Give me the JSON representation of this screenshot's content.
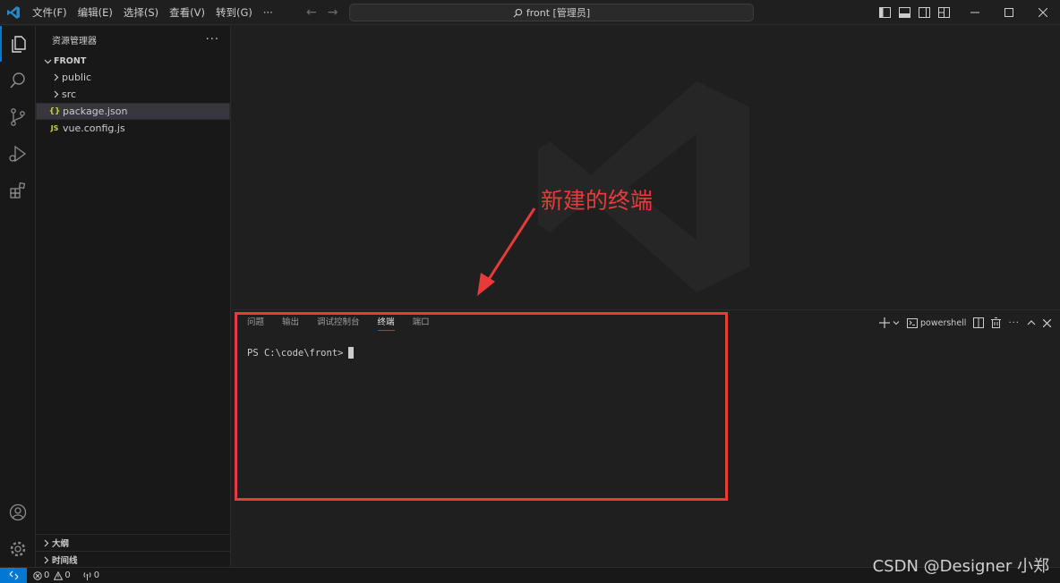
{
  "menu": [
    "文件(F)",
    "编辑(E)",
    "选择(S)",
    "查看(V)",
    "转到(G)",
    "···"
  ],
  "command_center": {
    "text": "front [管理员]"
  },
  "sidebar": {
    "title": "资源管理器",
    "more": "···",
    "folder": "FRONT",
    "items": [
      {
        "label": "public",
        "type": "folder"
      },
      {
        "label": "src",
        "type": "folder"
      },
      {
        "label": "package.json",
        "type": "json",
        "icon_text": "{}"
      },
      {
        "label": "vue.config.js",
        "type": "js",
        "icon_text": "JS"
      }
    ],
    "sections": [
      "大纲",
      "时间线"
    ]
  },
  "annotation": {
    "text": "新建的终端",
    "color": "#e83a3a"
  },
  "panel": {
    "tabs": [
      "问题",
      "输出",
      "调试控制台",
      "终端",
      "端口"
    ],
    "active_tab": "终端",
    "shell": "powershell",
    "prompt": "PS C:\\code\\front>"
  },
  "status": {
    "errors": "0",
    "warnings": "0",
    "ports": "0"
  },
  "watermark_text": "CSDN @Designer 小郑",
  "colors": {
    "accent": "#0078d4",
    "annotation": "#e83a3a",
    "background": "#1f1f1f"
  }
}
